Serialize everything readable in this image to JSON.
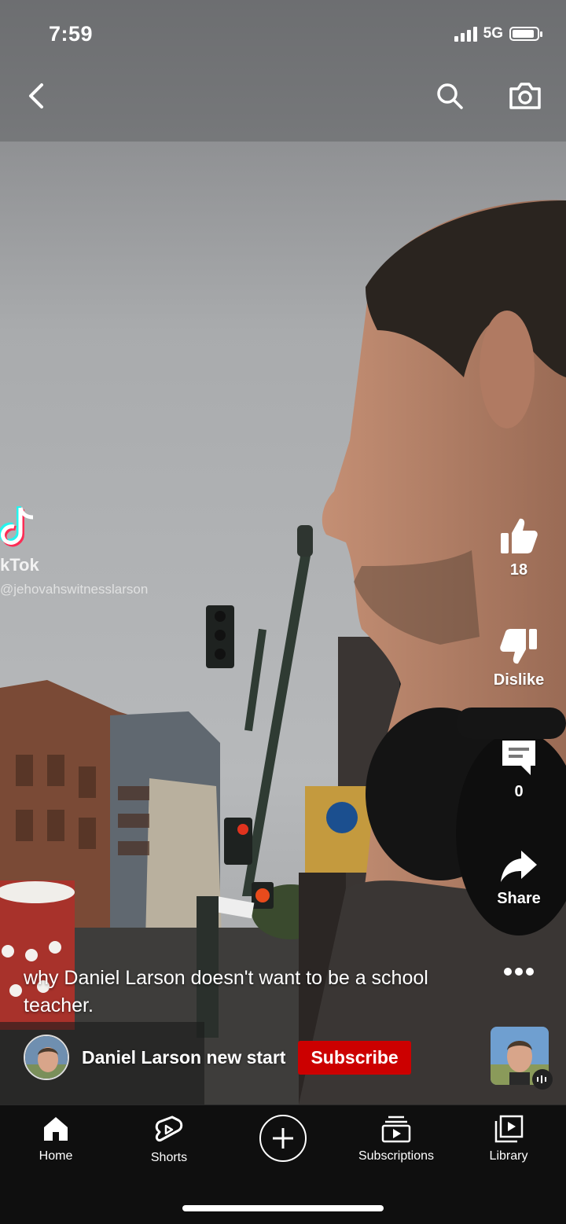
{
  "status_bar": {
    "time": "7:59",
    "network": "5G",
    "battery_level": 0.9
  },
  "video": {
    "watermark": {
      "brand": "kTok",
      "handle": "@jehovahswitnesslarson"
    },
    "caption": "why Daniel Larson doesn't want to be a school teacher.",
    "channel": {
      "name": "Daniel Larson new start",
      "subscribe_label": "Subscribe"
    }
  },
  "actions": {
    "like_count": "18",
    "dislike_label": "Dislike",
    "comments_count": "0",
    "share_label": "Share"
  },
  "nav": {
    "home": "Home",
    "shorts": "Shorts",
    "subscriptions": "Subscriptions",
    "library": "Library"
  },
  "colors": {
    "subscribe": "#cc0000",
    "nav_bg": "#0f0f0f"
  },
  "icons": [
    "back-arrow-icon",
    "search-icon",
    "camera-icon",
    "like-icon",
    "dislike-icon",
    "comment-icon",
    "share-icon",
    "more-icon",
    "home-icon",
    "shorts-icon",
    "create-icon",
    "subscriptions-icon",
    "library-icon"
  ]
}
